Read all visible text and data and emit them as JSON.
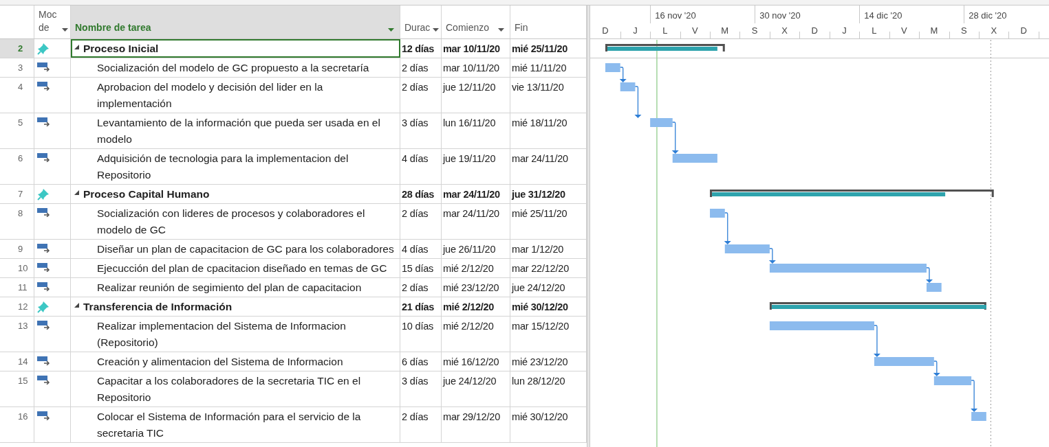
{
  "columns": [
    {
      "kind": "mode",
      "lines": [
        "Moc",
        "de"
      ],
      "selected": false
    },
    {
      "kind": "name",
      "lines": [
        "Nombre de tarea"
      ],
      "selected": true
    },
    {
      "kind": "duration",
      "lines": [
        "Durac"
      ],
      "selected": false
    },
    {
      "kind": "start",
      "lines": [
        "Comienzo"
      ],
      "selected": false
    },
    {
      "kind": "finish",
      "lines": [
        "Fin"
      ],
      "selected": false
    }
  ],
  "timescale": {
    "weeks": [
      "16 nov '20",
      "30 nov '20",
      "14 dic '20",
      "28 dic '20"
    ],
    "days": [
      "D",
      "J",
      "L",
      "V",
      "M",
      "S",
      "X",
      "D",
      "J",
      "L",
      "V",
      "M",
      "S",
      "X",
      "D"
    ]
  },
  "tasks": [
    {
      "id": "2",
      "kind": "summary",
      "manual": true,
      "selected": true,
      "name": "Proceso Inicial",
      "duration": "12 días",
      "start": "mar 10/11/20",
      "finish": "mié 25/11/20"
    },
    {
      "id": "3",
      "kind": "task",
      "manual": false,
      "selected": false,
      "name": "Socialización del modelo de GC propuesto a la secretaría",
      "duration": "2 días",
      "start": "mar 10/11/20",
      "finish": "mié 11/11/20"
    },
    {
      "id": "4",
      "kind": "task",
      "manual": false,
      "selected": false,
      "name": "Aprobacion del modelo y decisión del lider en la\nimplementación",
      "duration": "2 días",
      "start": "jue 12/11/20",
      "finish": "vie 13/11/20"
    },
    {
      "id": "5",
      "kind": "task",
      "manual": false,
      "selected": false,
      "name": "Levantamiento de la información que pueda ser usada en el\nmodelo",
      "duration": "3 días",
      "start": "lun 16/11/20",
      "finish": "mié 18/11/20"
    },
    {
      "id": "6",
      "kind": "task",
      "manual": false,
      "selected": false,
      "name": "Adquisición de tecnologia para la implementacion del\nRepositorio",
      "duration": "4 días",
      "start": "jue 19/11/20",
      "finish": "mar 24/11/20"
    },
    {
      "id": "7",
      "kind": "summary",
      "manual": true,
      "selected": false,
      "name": "Proceso Capital Humano",
      "duration": "28 días",
      "start": "mar 24/11/20",
      "finish": "jue 31/12/20"
    },
    {
      "id": "8",
      "kind": "task",
      "manual": false,
      "selected": false,
      "name": "Socialización con lideres de procesos y colaboradores el\nmodelo de GC",
      "duration": "2 días",
      "start": "mar 24/11/20",
      "finish": "mié 25/11/20"
    },
    {
      "id": "9",
      "kind": "task",
      "manual": false,
      "selected": false,
      "name": "Diseñar un plan de capacitacion de GC para los colaboradores",
      "duration": "4 días",
      "start": "jue 26/11/20",
      "finish": "mar 1/12/20"
    },
    {
      "id": "10",
      "kind": "task",
      "manual": false,
      "selected": false,
      "name": "Ejecucción del plan de cpacitacion diseñado en temas de GC",
      "duration": "15 días",
      "start": "mié 2/12/20",
      "finish": "mar 22/12/20"
    },
    {
      "id": "11",
      "kind": "task",
      "manual": false,
      "selected": false,
      "name": "Realizar reunión de segimiento del plan de capacitacion",
      "duration": "2 días",
      "start": "mié 23/12/20",
      "finish": "jue 24/12/20"
    },
    {
      "id": "12",
      "kind": "summary",
      "manual": true,
      "selected": false,
      "name": "Transferencia de Información",
      "duration": "21 días",
      "start": "mié 2/12/20",
      "finish": "mié 30/12/20"
    },
    {
      "id": "13",
      "kind": "task",
      "manual": false,
      "selected": false,
      "name": "Realizar implementacion del Sistema de Informacion\n(Repositorio)",
      "duration": "10 días",
      "start": "mié 2/12/20",
      "finish": "mar 15/12/20"
    },
    {
      "id": "14",
      "kind": "task",
      "manual": false,
      "selected": false,
      "name": "Creación y alimentacion del Sistema de Informacion",
      "duration": "6 días",
      "start": "mié 16/12/20",
      "finish": "mié 23/12/20"
    },
    {
      "id": "15",
      "kind": "task",
      "manual": false,
      "selected": false,
      "name": "Capacitar a los colaboradores de la secretaria TIC en el\nRepositorio",
      "duration": "3 días",
      "start": "jue 24/12/20",
      "finish": "lun 28/12/20"
    },
    {
      "id": "16",
      "kind": "task",
      "manual": false,
      "selected": false,
      "name": "Colocar el Sistema de Información para el servicio de la\nsecretaria TIC",
      "duration": "2 días",
      "start": "mar 29/12/20",
      "finish": "mié 30/12/20"
    }
  ]
}
